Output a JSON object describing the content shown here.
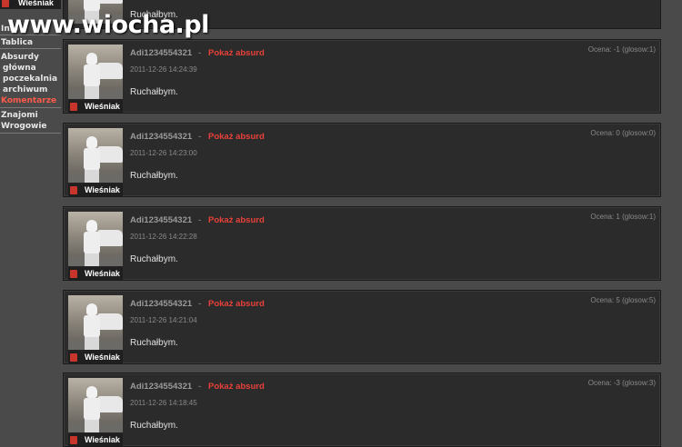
{
  "watermark": "www.wiocha.pl",
  "sidebar": {
    "items": [
      {
        "label": "Info",
        "active": false
      },
      {
        "label": "Tablica",
        "active": false
      },
      {
        "label": "Absurdy",
        "active": false
      },
      {
        "label": "główna",
        "active": false
      },
      {
        "label": "poczekalnia",
        "active": false
      },
      {
        "label": "archiwum",
        "active": false
      },
      {
        "label": "Komentarze",
        "active": true
      },
      {
        "label": "Znajomi",
        "active": false
      },
      {
        "label": "Wrogowie",
        "active": false
      }
    ]
  },
  "badge_label": "Wieśniak",
  "top_partial": {
    "text": "Ruchałbym."
  },
  "comments": [
    {
      "author": "Adi1234554321",
      "separator": "-",
      "link": "Pokaż absurd",
      "date": "2011-12-26 14:24:39",
      "rating": "Ocena: -1 (glosow:1)",
      "text": "Ruchałbym."
    },
    {
      "author": "Adi1234554321",
      "separator": "-",
      "link": "Pokaż absurd",
      "date": "2011-12-26 14:23:00",
      "rating": "Ocena: 0 (glosow:0)",
      "text": "Ruchałbym."
    },
    {
      "author": "Adi1234554321",
      "separator": "-",
      "link": "Pokaż absurd",
      "date": "2011-12-26 14:22:28",
      "rating": "Ocena: 1 (glosow:1)",
      "text": "Ruchałbym."
    },
    {
      "author": "Adi1234554321",
      "separator": "-",
      "link": "Pokaż absurd",
      "date": "2011-12-26 14:21:04",
      "rating": "Ocena: 5 (glosow:5)",
      "text": "Ruchałbym."
    },
    {
      "author": "Adi1234554321",
      "separator": "-",
      "link": "Pokaż absurd",
      "date": "2011-12-26 14:18:45",
      "rating": "Ocena: -3 (glosow:3)",
      "text": "Ruchałbym."
    }
  ]
}
